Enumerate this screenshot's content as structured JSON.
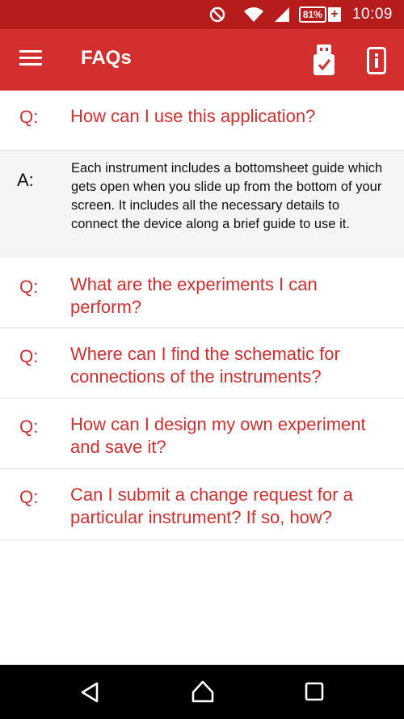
{
  "status_bar": {
    "battery_percent": "81%",
    "battery_plus": "+",
    "time": "10:09"
  },
  "app_bar": {
    "title": "FAQs",
    "icons": [
      "menu-icon",
      "usb-check-icon",
      "device-info-icon"
    ]
  },
  "faqs": [
    {
      "q_label": "Q:",
      "question": "How can I use this application?",
      "expanded": true,
      "a_label": "A:",
      "answer": "Each instrument includes a bottomsheet guide which gets open when you slide up from the bottom of your screen. It includes all the necessary details to connect the device along a brief guide to use it."
    },
    {
      "q_label": "Q:",
      "question": "What are the experiments I can perform?",
      "expanded": false
    },
    {
      "q_label": "Q:",
      "question": "Where can I find the schematic for connections of the instruments?",
      "expanded": false
    },
    {
      "q_label": "Q:",
      "question": "How can I design my own experiment and save it?",
      "expanded": false
    },
    {
      "q_label": "Q:",
      "question": "Can I submit a change request for a particular instrument? If so, how?",
      "expanded": false
    }
  ],
  "nav_bar": {
    "icons": [
      "back-icon",
      "home-icon",
      "recents-icon"
    ]
  },
  "colors": {
    "status_bar": "#b71c1c",
    "app_bar": "#d32f2f",
    "accent_text": "#d32f2f",
    "answer_bg": "#f5f5f5",
    "nav_bar": "#000000"
  }
}
